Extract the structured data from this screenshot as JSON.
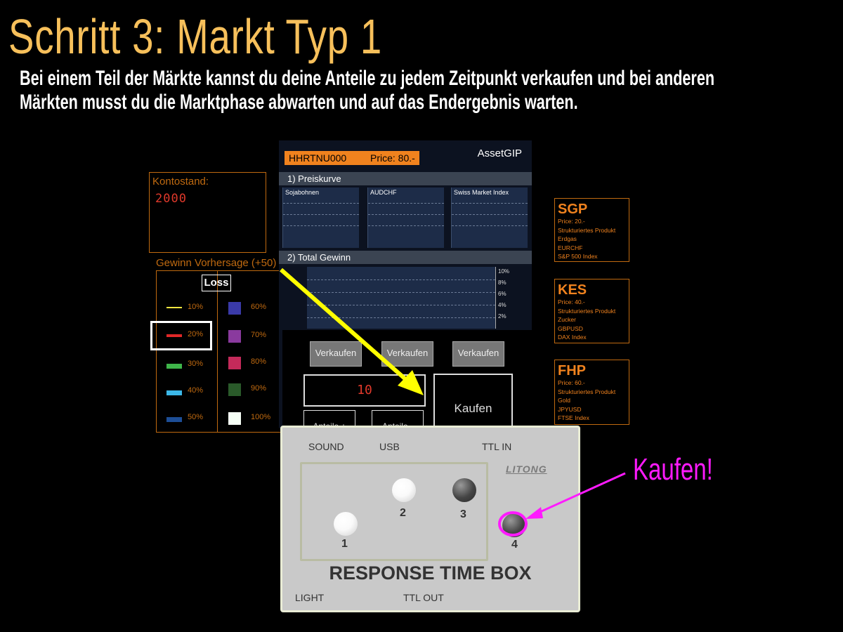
{
  "slide": {
    "title": "Schritt 3: Markt Typ 1",
    "subtitle_line1": "Bei einem Teil der Märkte kannst du deine Anteile zu jedem Zeitpunkt verkaufen und bei anderen",
    "subtitle_line2": "Märkten musst du die Marktphase abwarten und auf das Endergebnis warten."
  },
  "account": {
    "label": "Kontostand:",
    "value": "2000"
  },
  "prediction": {
    "label": "Gewinn Vorhersage (+50)",
    "loss_label": "Loss",
    "items": [
      {
        "label": "10%",
        "color": "#f2e640"
      },
      {
        "label": "20%",
        "color": "#e02828"
      },
      {
        "label": "30%",
        "color": "#3fb54a"
      },
      {
        "label": "40%",
        "color": "#3cb8e8"
      },
      {
        "label": "50%",
        "color": "#1d4e96"
      },
      {
        "label": "60%",
        "color": "#3a3aa8"
      },
      {
        "label": "70%",
        "color": "#8a3a9e"
      },
      {
        "label": "80%",
        "color": "#c42a5a"
      },
      {
        "label": "90%",
        "color": "#2a5a2a"
      },
      {
        "label": "100%",
        "color": "#f6fff6"
      }
    ]
  },
  "asset": {
    "code": "HHRTNU000",
    "price": "Price: 80.-",
    "name": "AssetGIP",
    "section1": "1) Preiskurve",
    "section2": "2) Total Gewinn",
    "charts": [
      "Sojabohnen",
      "AUDCHF",
      "Swiss Market Index"
    ],
    "gain_ticks": [
      "10%",
      "8%",
      "6%",
      "4%",
      "2%"
    ],
    "sell_label": "Verkaufen",
    "quantity": "10",
    "buy_label": "Kaufen",
    "shares_label": "Anteile +",
    "shares_minus_label": "Anteile -"
  },
  "products": [
    {
      "name": "SGP",
      "lines": [
        "Price: 20.-",
        "Strukturiertes Produkt",
        "Erdgas",
        "EURCHF",
        "S&P 500 Index"
      ]
    },
    {
      "name": "KES",
      "lines": [
        "Price: 40.-",
        "Strukturiertes Produkt",
        "Zucker",
        "GBPUSD",
        "DAX Index"
      ]
    },
    {
      "name": "FHP",
      "lines": [
        "Price: 60.-",
        "Strukturiertes Produkt",
        "Gold",
        "JPYUSD",
        "FTSE Index"
      ]
    }
  ],
  "response_box": {
    "sound": "SOUND",
    "usb": "USB",
    "ttl_in": "TTL IN",
    "brand": "LITONG",
    "buttons": [
      "1",
      "2",
      "3",
      "4"
    ],
    "title": "RESPONSE TIME BOX",
    "light": "LIGHT",
    "ttl_out": "TTL OUT"
  },
  "annotation": {
    "label": "Kaufen!",
    "color": "#ff1aff"
  },
  "colors": {
    "title": "#F7C05B",
    "accent": "#F0821E",
    "arrow": "#ffff00"
  }
}
